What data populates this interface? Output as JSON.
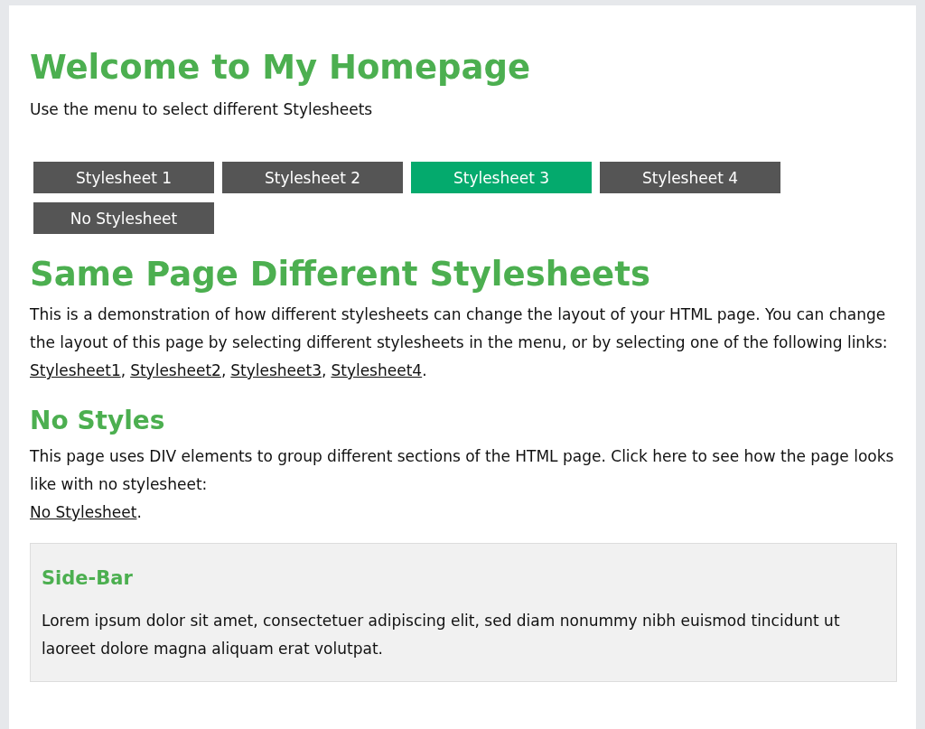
{
  "header": {
    "title": "Welcome to My Homepage",
    "subtitle": "Use the menu to select different Stylesheets"
  },
  "menu": [
    {
      "label": "Stylesheet 1",
      "selected": false
    },
    {
      "label": "Stylesheet 2",
      "selected": false
    },
    {
      "label": "Stylesheet 3",
      "selected": true
    },
    {
      "label": "Stylesheet 4",
      "selected": false
    },
    {
      "label": "No Stylesheet",
      "selected": false
    }
  ],
  "main": {
    "title": "Same Page Different Stylesheets",
    "text": "This is a demonstration of how different stylesheets can change the layout of your HTML page. You can change the layout of this page by selecting different stylesheets in the menu, or by selecting one of the following links:",
    "links": [
      {
        "label": "Stylesheet1",
        "after": ","
      },
      {
        "label": "Stylesheet2",
        "after": ","
      },
      {
        "label": "Stylesheet3",
        "after": ","
      },
      {
        "label": "Stylesheet4",
        "after": "."
      }
    ]
  },
  "no_styles": {
    "title": "No Styles",
    "text": "This page uses DIV elements to group different sections of the HTML page. Click here to see how the page looks like with no stylesheet:",
    "links": [
      {
        "label": "No Stylesheet",
        "after": "."
      }
    ]
  },
  "sidebar": {
    "title": "Side-Bar",
    "text": "Lorem ipsum dolor sit amet, consectetuer adipiscing elit, sed diam nonummy nibh euismod tincidunt ut laoreet dolore magna aliquam erat volutpat."
  }
}
